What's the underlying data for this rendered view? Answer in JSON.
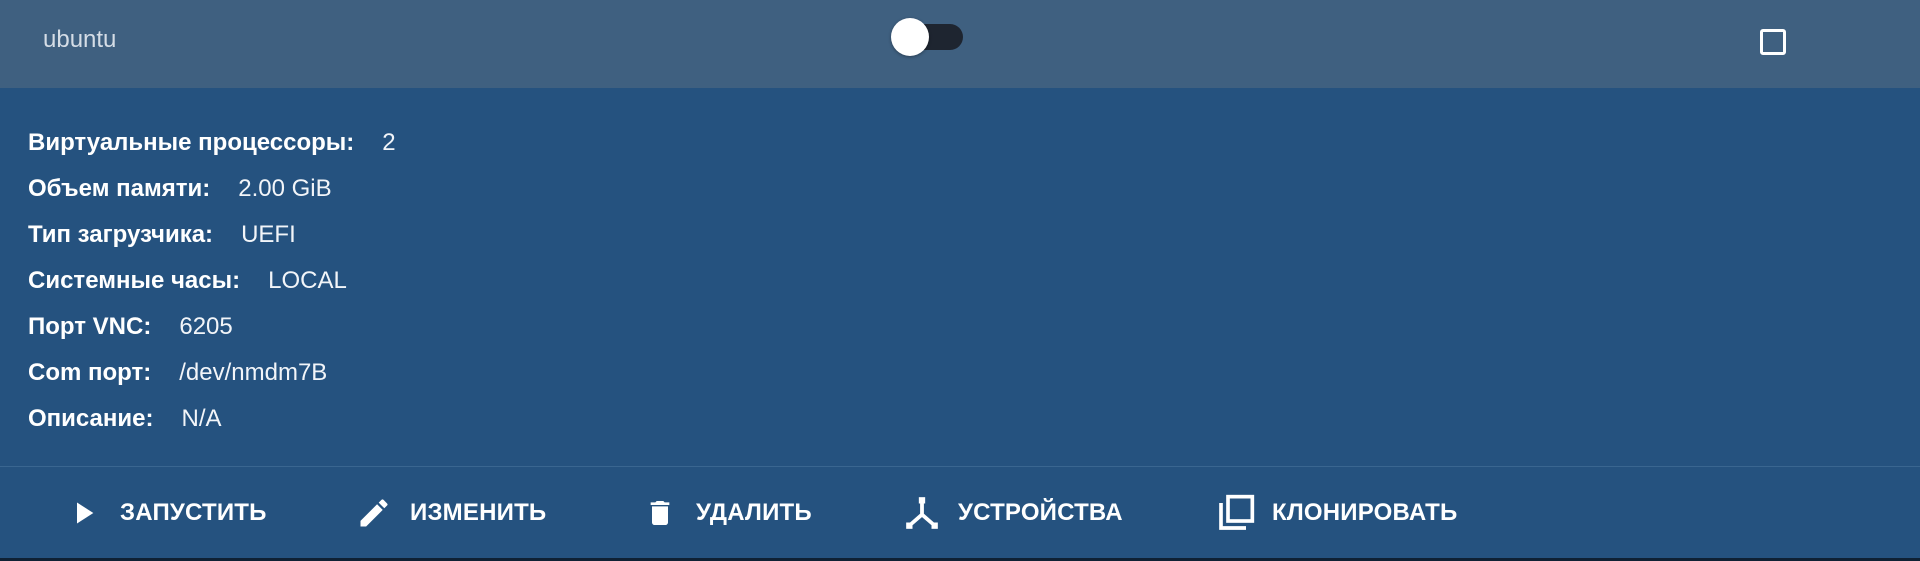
{
  "header": {
    "vm_name": "ubuntu"
  },
  "toggle": {
    "state": "off"
  },
  "details": [
    {
      "label": "Виртуальные процессоры:",
      "value": "2"
    },
    {
      "label": "Объем памяти:",
      "value": "2.00 GiB"
    },
    {
      "label": "Тип загрузчика:",
      "value": "UEFI"
    },
    {
      "label": "Системные часы:",
      "value": "LOCAL"
    },
    {
      "label": "Порт VNC:",
      "value": "6205"
    },
    {
      "label": "Com порт:",
      "value": "/dev/nmdm7B"
    },
    {
      "label": "Описание:",
      "value": "N/A"
    }
  ],
  "actions": [
    {
      "label": "ЗАПУСТИТЬ",
      "icon": "play-icon"
    },
    {
      "label": "ИЗМЕНИТЬ",
      "icon": "pencil-icon"
    },
    {
      "label": "УДАЛИТЬ",
      "icon": "trash-icon"
    },
    {
      "label": "УСТРОЙСТВА",
      "icon": "devices-icon"
    },
    {
      "label": "КЛОНИРОВАТЬ",
      "icon": "copy-icon"
    }
  ],
  "colors": {
    "card_background": "#25527f",
    "header_background": "#3f6080",
    "text": "#ffffff"
  }
}
